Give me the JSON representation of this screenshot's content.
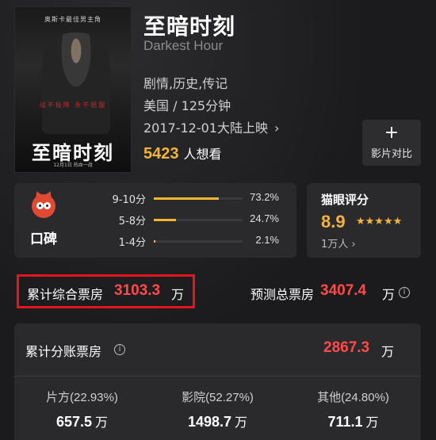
{
  "poster": {
    "tagline": "奥斯卡最佳男主角",
    "red_text": "战不投降  永不屈服",
    "title": "至暗时刻",
    "small_text": "12月1日  热血一战"
  },
  "movie": {
    "title": "至暗时刻",
    "original_title": "Darkest Hour",
    "genres": "剧情,历史,传记",
    "country_runtime": "美国 / 125分钟",
    "release": "2017-12-01大陆上映",
    "want_count": "5423",
    "want_label": "人想看"
  },
  "compare_button": {
    "icon": "+",
    "label": "影片对比"
  },
  "word_of_mouth": {
    "label": "口碑",
    "rows": [
      {
        "label": "9-10分",
        "percent": "73.2%",
        "fill": 0.732
      },
      {
        "label": "5-8分",
        "percent": "24.7%",
        "fill": 0.247
      },
      {
        "label": "1-4分",
        "percent": "2.1%",
        "fill": 0.021
      }
    ]
  },
  "maoyan": {
    "title": "猫眼评分",
    "score": "8.9",
    "stars": "★★★★★",
    "count": "1万人 ›"
  },
  "box_office": {
    "cumulative_label": "累计综合票房",
    "cumulative_value": "3103.3",
    "cumulative_unit": "万",
    "predicted_label": "预测总票房",
    "predicted_value": "3407.4",
    "predicted_unit": "万",
    "split_label": "累计分账票房",
    "split_value": "2867.3",
    "split_unit": "万",
    "columns": [
      {
        "label": "片方(22.93%)",
        "value": "657.5",
        "unit": "万"
      },
      {
        "label": "影院(52.27%)",
        "value": "1498.7",
        "unit": "万"
      },
      {
        "label": "其他(24.80%)",
        "value": "711.1",
        "unit": "万"
      }
    ]
  },
  "colors": {
    "accent": "#f3b33d",
    "red": "#ff4a4a",
    "frame": "#e3161b"
  }
}
